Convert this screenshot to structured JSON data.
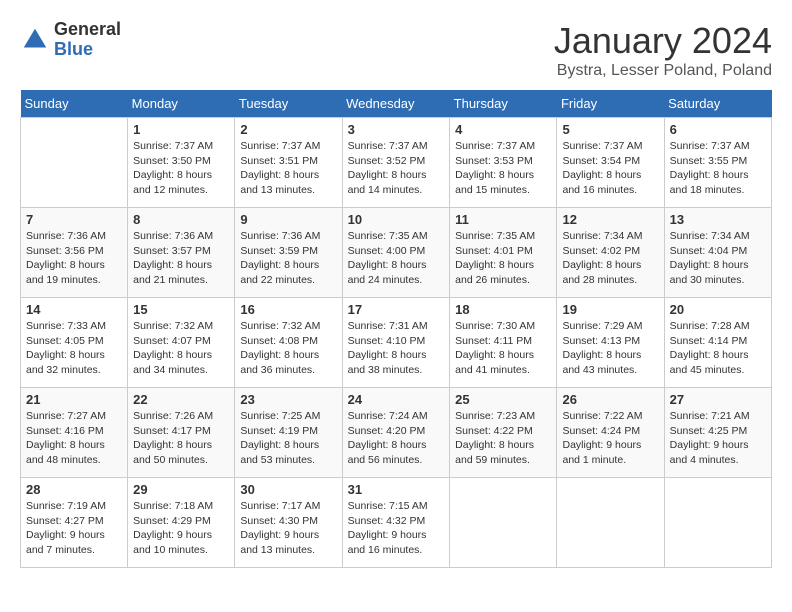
{
  "logo": {
    "general": "General",
    "blue": "Blue"
  },
  "title": "January 2024",
  "location": "Bystra, Lesser Poland, Poland",
  "weekdays": [
    "Sunday",
    "Monday",
    "Tuesday",
    "Wednesday",
    "Thursday",
    "Friday",
    "Saturday"
  ],
  "weeks": [
    [
      {
        "date": "",
        "sunrise": "",
        "sunset": "",
        "daylight": ""
      },
      {
        "date": "1",
        "sunrise": "Sunrise: 7:37 AM",
        "sunset": "Sunset: 3:50 PM",
        "daylight": "Daylight: 8 hours and 12 minutes."
      },
      {
        "date": "2",
        "sunrise": "Sunrise: 7:37 AM",
        "sunset": "Sunset: 3:51 PM",
        "daylight": "Daylight: 8 hours and 13 minutes."
      },
      {
        "date": "3",
        "sunrise": "Sunrise: 7:37 AM",
        "sunset": "Sunset: 3:52 PM",
        "daylight": "Daylight: 8 hours and 14 minutes."
      },
      {
        "date": "4",
        "sunrise": "Sunrise: 7:37 AM",
        "sunset": "Sunset: 3:53 PM",
        "daylight": "Daylight: 8 hours and 15 minutes."
      },
      {
        "date": "5",
        "sunrise": "Sunrise: 7:37 AM",
        "sunset": "Sunset: 3:54 PM",
        "daylight": "Daylight: 8 hours and 16 minutes."
      },
      {
        "date": "6",
        "sunrise": "Sunrise: 7:37 AM",
        "sunset": "Sunset: 3:55 PM",
        "daylight": "Daylight: 8 hours and 18 minutes."
      }
    ],
    [
      {
        "date": "7",
        "sunrise": "Sunrise: 7:36 AM",
        "sunset": "Sunset: 3:56 PM",
        "daylight": "Daylight: 8 hours and 19 minutes."
      },
      {
        "date": "8",
        "sunrise": "Sunrise: 7:36 AM",
        "sunset": "Sunset: 3:57 PM",
        "daylight": "Daylight: 8 hours and 21 minutes."
      },
      {
        "date": "9",
        "sunrise": "Sunrise: 7:36 AM",
        "sunset": "Sunset: 3:59 PM",
        "daylight": "Daylight: 8 hours and 22 minutes."
      },
      {
        "date": "10",
        "sunrise": "Sunrise: 7:35 AM",
        "sunset": "Sunset: 4:00 PM",
        "daylight": "Daylight: 8 hours and 24 minutes."
      },
      {
        "date": "11",
        "sunrise": "Sunrise: 7:35 AM",
        "sunset": "Sunset: 4:01 PM",
        "daylight": "Daylight: 8 hours and 26 minutes."
      },
      {
        "date": "12",
        "sunrise": "Sunrise: 7:34 AM",
        "sunset": "Sunset: 4:02 PM",
        "daylight": "Daylight: 8 hours and 28 minutes."
      },
      {
        "date": "13",
        "sunrise": "Sunrise: 7:34 AM",
        "sunset": "Sunset: 4:04 PM",
        "daylight": "Daylight: 8 hours and 30 minutes."
      }
    ],
    [
      {
        "date": "14",
        "sunrise": "Sunrise: 7:33 AM",
        "sunset": "Sunset: 4:05 PM",
        "daylight": "Daylight: 8 hours and 32 minutes."
      },
      {
        "date": "15",
        "sunrise": "Sunrise: 7:32 AM",
        "sunset": "Sunset: 4:07 PM",
        "daylight": "Daylight: 8 hours and 34 minutes."
      },
      {
        "date": "16",
        "sunrise": "Sunrise: 7:32 AM",
        "sunset": "Sunset: 4:08 PM",
        "daylight": "Daylight: 8 hours and 36 minutes."
      },
      {
        "date": "17",
        "sunrise": "Sunrise: 7:31 AM",
        "sunset": "Sunset: 4:10 PM",
        "daylight": "Daylight: 8 hours and 38 minutes."
      },
      {
        "date": "18",
        "sunrise": "Sunrise: 7:30 AM",
        "sunset": "Sunset: 4:11 PM",
        "daylight": "Daylight: 8 hours and 41 minutes."
      },
      {
        "date": "19",
        "sunrise": "Sunrise: 7:29 AM",
        "sunset": "Sunset: 4:13 PM",
        "daylight": "Daylight: 8 hours and 43 minutes."
      },
      {
        "date": "20",
        "sunrise": "Sunrise: 7:28 AM",
        "sunset": "Sunset: 4:14 PM",
        "daylight": "Daylight: 8 hours and 45 minutes."
      }
    ],
    [
      {
        "date": "21",
        "sunrise": "Sunrise: 7:27 AM",
        "sunset": "Sunset: 4:16 PM",
        "daylight": "Daylight: 8 hours and 48 minutes."
      },
      {
        "date": "22",
        "sunrise": "Sunrise: 7:26 AM",
        "sunset": "Sunset: 4:17 PM",
        "daylight": "Daylight: 8 hours and 50 minutes."
      },
      {
        "date": "23",
        "sunrise": "Sunrise: 7:25 AM",
        "sunset": "Sunset: 4:19 PM",
        "daylight": "Daylight: 8 hours and 53 minutes."
      },
      {
        "date": "24",
        "sunrise": "Sunrise: 7:24 AM",
        "sunset": "Sunset: 4:20 PM",
        "daylight": "Daylight: 8 hours and 56 minutes."
      },
      {
        "date": "25",
        "sunrise": "Sunrise: 7:23 AM",
        "sunset": "Sunset: 4:22 PM",
        "daylight": "Daylight: 8 hours and 59 minutes."
      },
      {
        "date": "26",
        "sunrise": "Sunrise: 7:22 AM",
        "sunset": "Sunset: 4:24 PM",
        "daylight": "Daylight: 9 hours and 1 minute."
      },
      {
        "date": "27",
        "sunrise": "Sunrise: 7:21 AM",
        "sunset": "Sunset: 4:25 PM",
        "daylight": "Daylight: 9 hours and 4 minutes."
      }
    ],
    [
      {
        "date": "28",
        "sunrise": "Sunrise: 7:19 AM",
        "sunset": "Sunset: 4:27 PM",
        "daylight": "Daylight: 9 hours and 7 minutes."
      },
      {
        "date": "29",
        "sunrise": "Sunrise: 7:18 AM",
        "sunset": "Sunset: 4:29 PM",
        "daylight": "Daylight: 9 hours and 10 minutes."
      },
      {
        "date": "30",
        "sunrise": "Sunrise: 7:17 AM",
        "sunset": "Sunset: 4:30 PM",
        "daylight": "Daylight: 9 hours and 13 minutes."
      },
      {
        "date": "31",
        "sunrise": "Sunrise: 7:15 AM",
        "sunset": "Sunset: 4:32 PM",
        "daylight": "Daylight: 9 hours and 16 minutes."
      },
      {
        "date": "",
        "sunrise": "",
        "sunset": "",
        "daylight": ""
      },
      {
        "date": "",
        "sunrise": "",
        "sunset": "",
        "daylight": ""
      },
      {
        "date": "",
        "sunrise": "",
        "sunset": "",
        "daylight": ""
      }
    ]
  ]
}
